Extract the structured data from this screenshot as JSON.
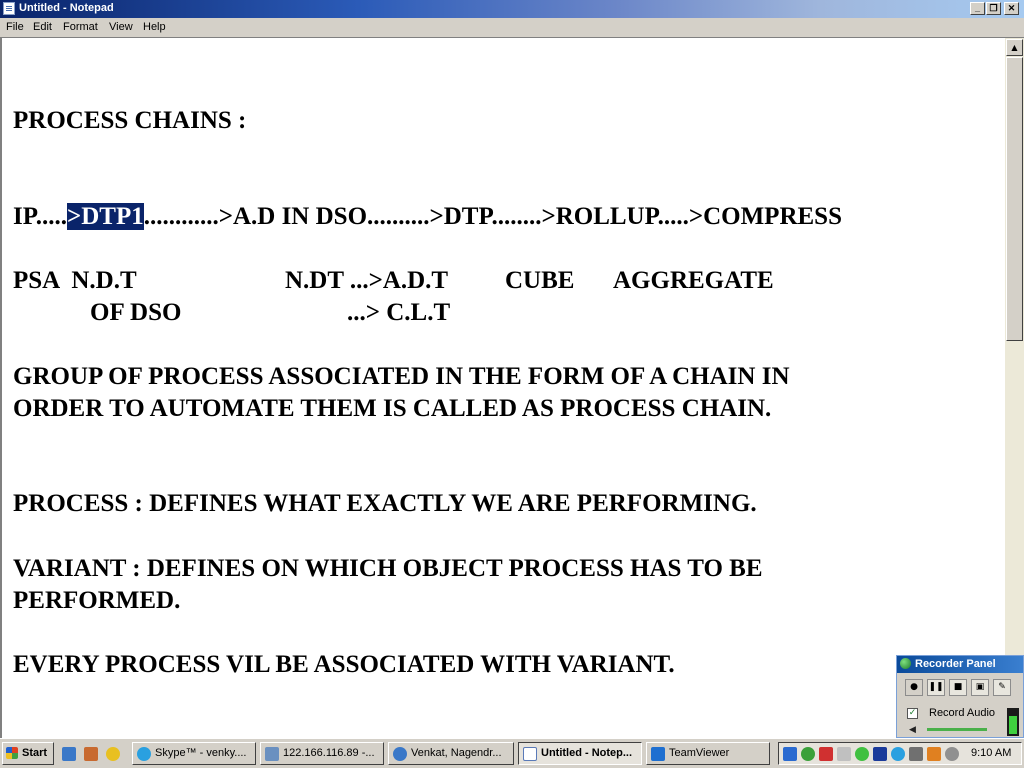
{
  "window": {
    "title": "Untitled - Notepad",
    "controls": {
      "minimize": "_",
      "restore": "❐",
      "close": "✕"
    }
  },
  "menu": [
    "File",
    "Edit",
    "Format",
    "View",
    "Help"
  ],
  "document": {
    "lines": {
      "heading": "PROCESS CHAINS :",
      "flow_prefix": "IP.....",
      "flow_selected": ">DTP1",
      "flow_suffix": "............>A.D IN DSO..........>DTP........>ROLLUP.....>COMPRESS",
      "row1_psa": "PSA  N.D.T",
      "row1_ndt": "N.DT ...>A.D.T",
      "row1_cube": "CUBE",
      "row1_aggregate": "AGGREGATE",
      "row2_of_dso": "OF DSO",
      "row2_clt": "...> C.L.T",
      "group1": "GROUP OF PROCESS ASSOCIATED IN THE FORM OF A CHAIN IN",
      "group2": "ORDER TO AUTOMATE THEM IS CALLED AS PROCESS CHAIN.",
      "process": "PROCESS : DEFINES WHAT EXACTLY WE ARE PERFORMING.",
      "variant1": "VARIANT : DEFINES ON WHICH OBJECT PROCESS HAS TO BE",
      "variant2": "PERFORMED.",
      "every": "EVERY PROCESS VIL BE ASSOCIATED WITH VARIANT."
    }
  },
  "recorder_panel": {
    "title": "Recorder Panel",
    "record_audio_label": "Record Audio",
    "record_audio_checked": true
  },
  "taskbar": {
    "start_label": "Start",
    "tasks": [
      {
        "label": "Skype™ - venky....",
        "icon": "skype-icon"
      },
      {
        "label": "122.166.116.89 -...",
        "icon": "remote-desktop-icon"
      },
      {
        "label": "Venkat, Nagendr...",
        "icon": "browser-icon"
      },
      {
        "label": "Untitled - Notep...",
        "icon": "notepad-icon",
        "active": true
      },
      {
        "label": "TeamViewer",
        "icon": "teamviewer-icon"
      }
    ],
    "clock": "9:10 AM"
  },
  "colors": {
    "selection": "#0a246a",
    "titlebar_start": "#0a246a",
    "chrome": "#d4d0c8"
  }
}
